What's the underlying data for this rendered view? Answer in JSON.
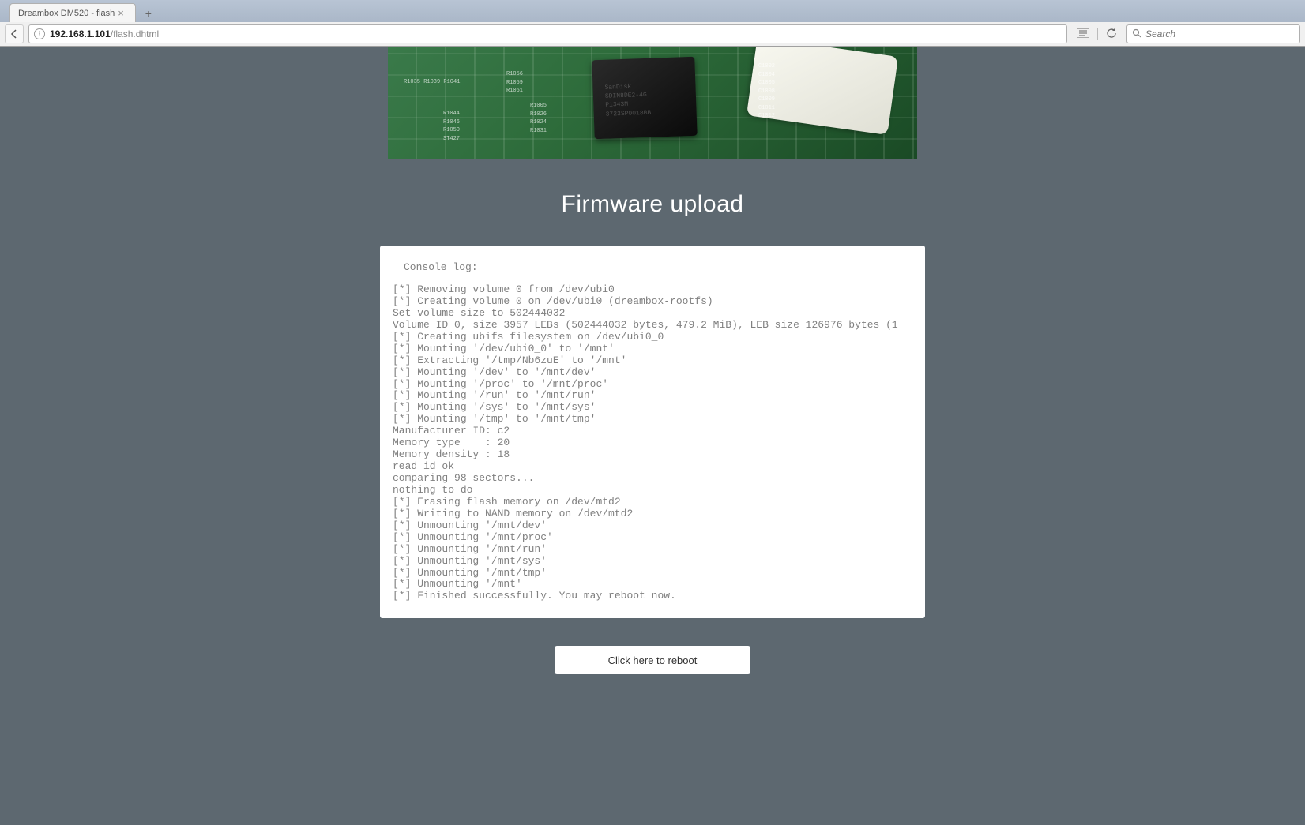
{
  "browser": {
    "tab_title": "Dreambox DM520 - flash",
    "url_host": "192.168.1.101",
    "url_path": "/flash.dhtml",
    "search_placeholder": "Search"
  },
  "page": {
    "title": "Firmware upload",
    "console_label": "Console log:",
    "console_log": "[*] Removing volume 0 from /dev/ubi0\n[*] Creating volume 0 on /dev/ubi0 (dreambox-rootfs)\nSet volume size to 502444032\nVolume ID 0, size 3957 LEBs (502444032 bytes, 479.2 MiB), LEB size 126976 bytes (1\n[*] Creating ubifs filesystem on /dev/ubi0_0\n[*] Mounting '/dev/ubi0_0' to '/mnt'\n[*] Extracting '/tmp/Nb6zuE' to '/mnt'\n[*] Mounting '/dev' to '/mnt/dev'\n[*] Mounting '/proc' to '/mnt/proc'\n[*] Mounting '/run' to '/mnt/run'\n[*] Mounting '/sys' to '/mnt/sys'\n[*] Mounting '/tmp' to '/mnt/tmp'\nManufacturer ID: c2\nMemory type    : 20\nMemory density : 18\nread id ok\ncomparing 98 sectors...\nnothing to do\n[*] Erasing flash memory on /dev/mtd2\n[*] Writing to NAND memory on /dev/mtd2\n[*] Unmounting '/mnt/dev'\n[*] Unmounting '/mnt/proc'\n[*] Unmounting '/mnt/run'\n[*] Unmounting '/mnt/sys'\n[*] Unmounting '/mnt/tmp'\n[*] Unmounting '/mnt'\n[*] Finished successfully. You may reboot now.",
    "reboot_button": "Click here to reboot"
  },
  "pcb_decor": {
    "chip_text": "SanDisk\nSDIN8DE2-4G\nP1343M\n3723SP0018BB",
    "left_labels": "R1035 R1039\nR1041",
    "mid_labels1": "R1044\nR1046\nR1050\nST427",
    "mid_labels2": "R1056\nR1059\nR1061",
    "mid_labels3": "R1005\nR1026\nR1024\nR1031",
    "right_labels": "C1002\nC1004\nC1005\nC1008\nC1009\nC1011\nC1012"
  }
}
